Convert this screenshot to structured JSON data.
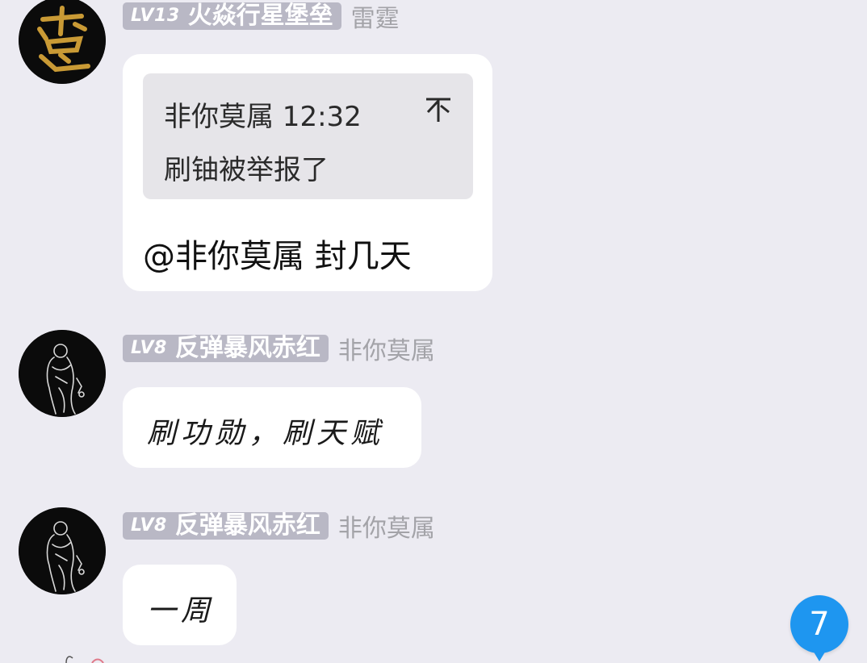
{
  "messages": [
    {
      "level": "LV13",
      "title": "火焱行星堡垒",
      "sender": "雷霆",
      "avatar_icon": "gold-calligraphy-avatar",
      "quote": {
        "author_time": "非你莫属 12:32",
        "text": "刷铀被举报了",
        "arrow_icon": "arrow-down-icon"
      },
      "text": "@非你莫属 封几天"
    },
    {
      "level": "LV8",
      "title": "反弹暴风赤红",
      "sender": "非你莫属",
      "avatar_icon": "monk-sketch-avatar",
      "text": "刷功勋，刷天赋"
    },
    {
      "level": "LV8",
      "title": "反弹暴风赤红",
      "sender": "非你莫属",
      "avatar_icon": "monk-sketch-avatar",
      "text": "一周"
    }
  ],
  "unread_badge": "7",
  "colors": {
    "background": "#ecebf2",
    "bubble": "#ffffff",
    "quote_bg": "#e6e5e9",
    "tag_bg": "#b9b8c5",
    "badge": "#1e96f0",
    "sender_text": "#a3a3a8",
    "avatar_gold": "#c99a35"
  }
}
